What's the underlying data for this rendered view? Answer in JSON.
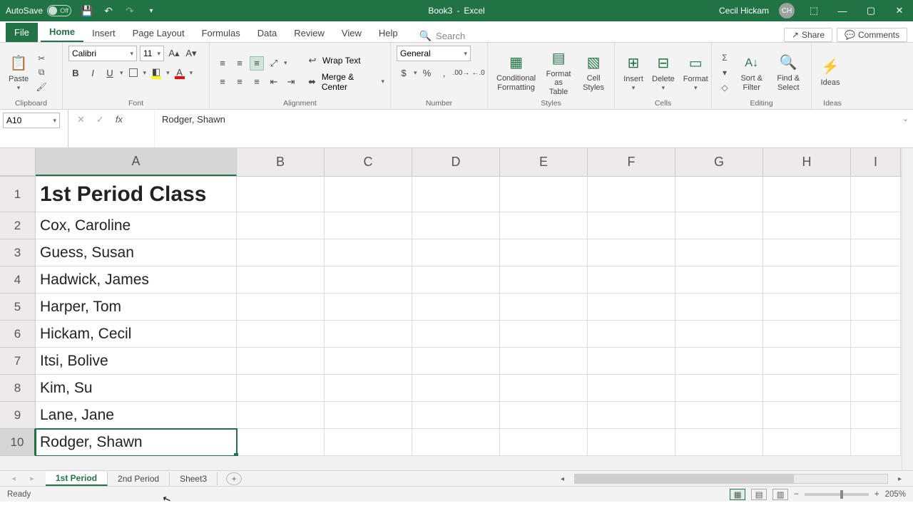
{
  "titlebar": {
    "autosave_label": "AutoSave",
    "autosave_state": "Off",
    "doc_title": "Book3",
    "app_name": "Excel",
    "user_name": "Cecil Hickam",
    "user_initials": "CH"
  },
  "menu": {
    "file": "File",
    "items": [
      "Home",
      "Insert",
      "Page Layout",
      "Formulas",
      "Data",
      "Review",
      "View",
      "Help"
    ],
    "active": "Home",
    "search_placeholder": "Search",
    "share": "Share",
    "comments": "Comments"
  },
  "ribbon": {
    "clipboard": {
      "paste": "Paste",
      "label": "Clipboard"
    },
    "font": {
      "name": "Calibri",
      "size": "11",
      "label": "Font"
    },
    "alignment": {
      "wrap": "Wrap Text",
      "merge": "Merge & Center",
      "label": "Alignment"
    },
    "number": {
      "format": "General",
      "label": "Number"
    },
    "styles": {
      "cond": "Conditional Formatting",
      "table": "Format as Table",
      "cell": "Cell Styles",
      "label": "Styles"
    },
    "cells": {
      "insert": "Insert",
      "delete": "Delete",
      "format": "Format",
      "label": "Cells"
    },
    "editing": {
      "sort": "Sort & Filter",
      "find": "Find & Select",
      "label": "Editing"
    },
    "ideas": {
      "btn": "Ideas",
      "label": "Ideas"
    }
  },
  "namebox": {
    "ref": "A10"
  },
  "formula_bar": {
    "value": "Rodger, Shawn"
  },
  "grid": {
    "columns": [
      "A",
      "B",
      "C",
      "D",
      "E",
      "F",
      "G",
      "H",
      "I"
    ],
    "selected_column": "A",
    "selected_row": 10,
    "rows": [
      {
        "n": 1,
        "A": "1st Period Class",
        "bold": true
      },
      {
        "n": 2,
        "A": "Cox, Caroline"
      },
      {
        "n": 3,
        "A": "Guess, Susan"
      },
      {
        "n": 4,
        "A": "Hadwick, James"
      },
      {
        "n": 5,
        "A": "Harper, Tom"
      },
      {
        "n": 6,
        "A": "Hickam, Cecil"
      },
      {
        "n": 7,
        "A": "Itsi, Bolive"
      },
      {
        "n": 8,
        "A": "Kim, Su"
      },
      {
        "n": 9,
        "A": "Lane, Jane"
      },
      {
        "n": 10,
        "A": "Rodger, Shawn",
        "active": true
      }
    ]
  },
  "sheet_tabs": {
    "tabs": [
      "1st Period",
      "2nd Period",
      "Sheet3"
    ],
    "active": "1st Period"
  },
  "statusbar": {
    "mode": "Ready",
    "zoom": "205%"
  },
  "chart_data": null
}
